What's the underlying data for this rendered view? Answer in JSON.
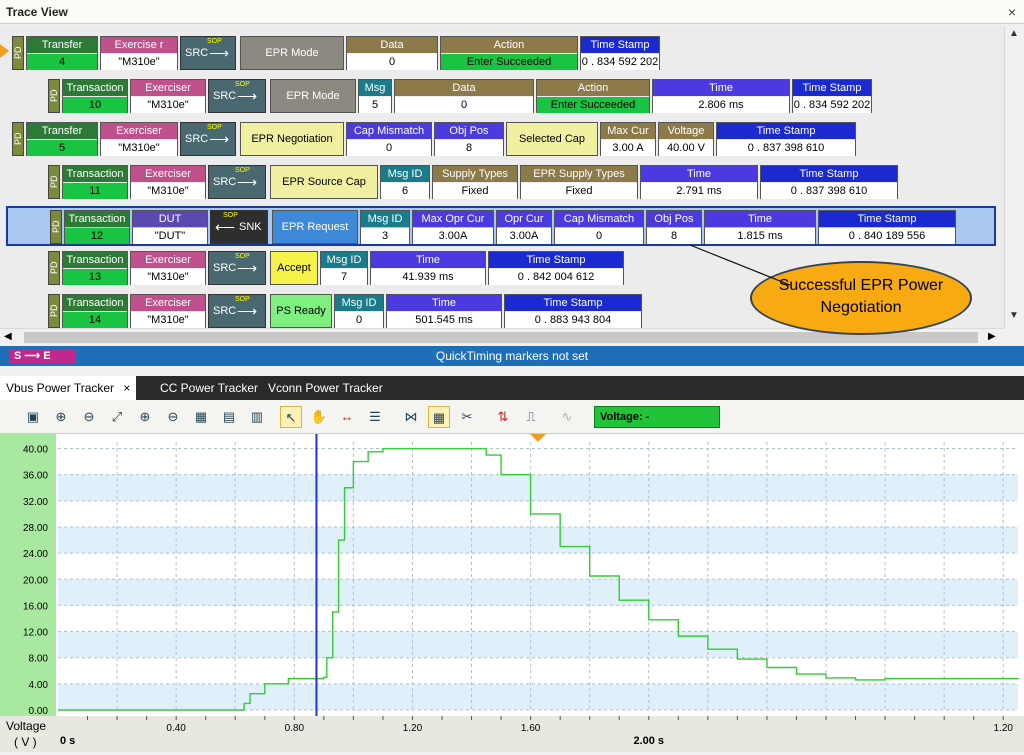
{
  "window": {
    "title": "Trace View",
    "close": "×"
  },
  "rows": [
    {
      "kind": "Transfer",
      "num": "4",
      "role": "Exercise r",
      "role_val": "\"M310e\"",
      "dir": "SRC",
      "cells": [
        {
          "type": "name",
          "label": "EPR Mode",
          "style": "grey"
        },
        {
          "h": "Data",
          "v": "0",
          "c": "olive"
        },
        {
          "h": "Action",
          "v": "Enter Succeeded",
          "c": "olive",
          "vg": true
        },
        {
          "h": "Time Stamp",
          "v": "0 . 834 592 202",
          "c": "blu"
        }
      ]
    },
    {
      "kind": "Transaction",
      "num": "10",
      "role": "Exerciser",
      "role_val": "\"M310e\"",
      "dir": "SRC",
      "cells": [
        {
          "type": "name",
          "label": "EPR Mode",
          "style": "grey"
        },
        {
          "h": "Msg ID",
          "v": "5",
          "c": "teal"
        },
        {
          "h": "Data",
          "v": "0",
          "c": "olive"
        },
        {
          "h": "Action",
          "v": "Enter Succeeded",
          "c": "olive",
          "vg": true
        },
        {
          "h": "Time",
          "v": "2.806 ms",
          "c": "blu2"
        },
        {
          "h": "Time Stamp",
          "v": "0 . 834 592 202",
          "c": "blu"
        }
      ]
    },
    {
      "kind": "Transfer",
      "num": "5",
      "role": "Exerciser",
      "role_val": "\"M310e\"",
      "dir": "SRC",
      "cells": [
        {
          "type": "name",
          "label": "EPR Negotiation",
          "style": "cream"
        },
        {
          "h": "Cap Mismatch",
          "v": "0",
          "c": "blu2"
        },
        {
          "h": "Obj Pos",
          "v": "8",
          "c": "blu2"
        },
        {
          "type": "name",
          "label": "Selected Cap",
          "style": "cream"
        },
        {
          "h": "Max Cur",
          "v": "3.00 A",
          "c": "olive"
        },
        {
          "h": "Voltage",
          "v": "40.00 V",
          "c": "olive"
        },
        {
          "h": "Time Stamp",
          "v": "0 . 837 398 610",
          "c": "blu"
        }
      ]
    },
    {
      "kind": "Transaction",
      "num": "11",
      "role": "Exerciser",
      "role_val": "\"M310e\"",
      "dir": "SRC",
      "cells": [
        {
          "type": "name",
          "label": "EPR Source Cap",
          "style": "cream"
        },
        {
          "h": "Msg ID",
          "v": "6",
          "c": "teal"
        },
        {
          "h": "Supply Types",
          "v": "Fixed",
          "c": "olive"
        },
        {
          "h": "EPR Supply Types",
          "v": "Fixed",
          "c": "olive"
        },
        {
          "h": "Time",
          "v": "2.791 ms",
          "c": "blu2"
        },
        {
          "h": "Time Stamp",
          "v": "0 . 837 398 610",
          "c": "blu"
        }
      ]
    },
    {
      "kind": "Transaction",
      "num": "12",
      "role": "DUT",
      "role_val": "\"DUT\"",
      "dir": "SNK",
      "sel": true,
      "cells": [
        {
          "type": "name",
          "label": "EPR Request",
          "style": "blu3"
        },
        {
          "h": "Msg ID",
          "v": "3",
          "c": "teal"
        },
        {
          "h": "Max Opr Cur",
          "v": "3.00A",
          "c": "blu2"
        },
        {
          "h": "Opr Cur",
          "v": "3.00A",
          "c": "blu2"
        },
        {
          "h": "Cap Mismatch",
          "v": "0",
          "c": "blu2"
        },
        {
          "h": "Obj Pos",
          "v": "8",
          "c": "blu2"
        },
        {
          "h": "Time",
          "v": "1.815 ms",
          "c": "blu2"
        },
        {
          "h": "Time Stamp",
          "v": "0 . 840 189 556",
          "c": "blu"
        }
      ]
    },
    {
      "kind": "Transaction",
      "num": "13",
      "role": "Exerciser",
      "role_val": "\"M310e\"",
      "dir": "SRC",
      "cells": [
        {
          "type": "name",
          "label": "Accept",
          "style": "yellow"
        },
        {
          "h": "Msg ID",
          "v": "7",
          "c": "teal"
        },
        {
          "h": "Time",
          "v": "41.939 ms",
          "c": "blu2"
        },
        {
          "h": "Time Stamp",
          "v": "0 . 842 004 612",
          "c": "blu"
        }
      ]
    },
    {
      "kind": "Transaction",
      "num": "14",
      "role": "Exerciser",
      "role_val": "\"M310e\"",
      "dir": "SRC",
      "cells": [
        {
          "type": "name",
          "label": "PS Ready",
          "style": "lime"
        },
        {
          "h": "Msg ID",
          "v": "0",
          "c": "teal"
        },
        {
          "h": "Time",
          "v": "501.545 ms",
          "c": "blu2"
        },
        {
          "h": "Time Stamp",
          "v": "0 . 883 943 804",
          "c": "blu"
        }
      ]
    }
  ],
  "pd_label": "PD",
  "sop_label": "SOP",
  "callout": "Successful EPR Power Negotiation",
  "quicktiming": {
    "se": "S ⟶ E",
    "msg": "QuickTiming markers not set"
  },
  "tabs": [
    {
      "label": "Vbus Power Tracker",
      "active": true
    },
    {
      "label": "CC Power Tracker"
    },
    {
      "label": "Vconn Power Tracker"
    }
  ],
  "tab_close": "×",
  "voltage_readout": "Voltage: -",
  "chart_data": {
    "type": "line",
    "ylabel": "Voltage",
    "yunit": "( V )",
    "yticks": [
      "0.00",
      "4.00",
      "8.00",
      "12.00",
      "16.00",
      "20.00",
      "24.00",
      "28.00",
      "32.00",
      "36.00",
      "40.00"
    ],
    "ylim": [
      0,
      41
    ],
    "xticks": [
      "0.40",
      "0.80",
      "1.20",
      "1.60",
      "2.00 s",
      "1.20"
    ],
    "xtick_vals": [
      0.4,
      0.8,
      1.2,
      1.6,
      2.0,
      3.2
    ],
    "x_start_label": "0 s",
    "xlim": [
      0,
      3.25
    ],
    "series": [
      {
        "color": "#33cc33",
        "x": [
          0.0,
          0.6,
          0.63,
          0.65,
          0.7,
          0.78,
          0.9,
          0.91,
          0.93,
          0.95,
          0.97,
          1.0,
          1.05,
          1.1,
          1.2,
          1.3,
          1.42,
          1.45,
          1.5,
          1.6,
          1.7,
          1.8,
          1.9,
          2.0,
          2.1,
          2.2,
          2.3,
          2.4,
          2.5,
          2.6,
          2.7,
          2.75,
          2.8,
          3.25
        ],
        "y": [
          0.0,
          0.0,
          1.0,
          2.5,
          4.0,
          4.8,
          5.0,
          8.0,
          15.0,
          26.0,
          34.0,
          38.0,
          39.5,
          40.0,
          40.0,
          40.0,
          40.0,
          39.0,
          36.0,
          30.0,
          25.0,
          20.5,
          16.8,
          13.8,
          11.3,
          9.3,
          7.8,
          6.5,
          5.5,
          4.9,
          4.6,
          4.6,
          4.8,
          4.9
        ]
      }
    ],
    "cursor_x": 0.875,
    "grid": true
  }
}
